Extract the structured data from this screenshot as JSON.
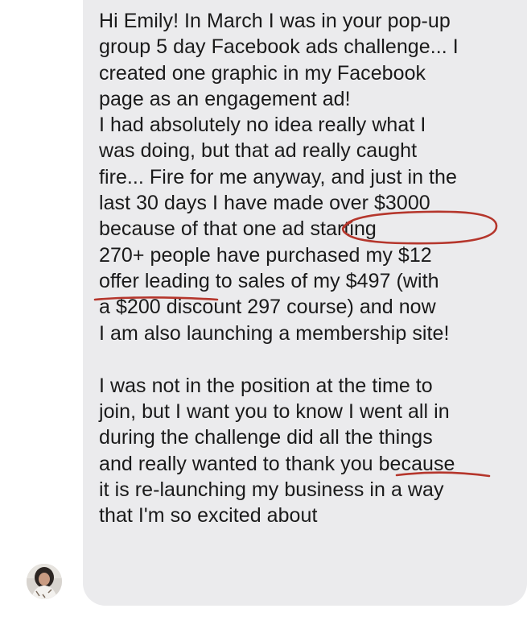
{
  "message": {
    "lines": [
      "Hi Emily! In March I was in your pop-up",
      "group 5 day Facebook ads challenge... I",
      "created one graphic in my Facebook",
      "page as an engagement ad!",
      "I had absolutely no idea really what I",
      "was doing, but that ad really caught",
      "fire... Fire for me anyway, and just in the",
      "last 30 days I have made over $3000",
      "because of that one ad starting",
      "270+ people have purchased my $12",
      "offer leading to sales of my $497 (with",
      "a $200 discount 297 course) and now",
      "I am also launching a membership site!",
      "",
      "I was not in the position at the time to",
      "join, but I want you to know I went all in",
      "during the challenge did all the things",
      "and really wanted to thank you because",
      "it is re-launching my business in a way",
      "that I'm so excited about"
    ]
  },
  "annotation": {
    "color": "#b5362c"
  },
  "colors": {
    "bubble": "#ebebed",
    "text": "#1a1a1a"
  },
  "icons": {
    "avatar": "sender-avatar-photo"
  }
}
